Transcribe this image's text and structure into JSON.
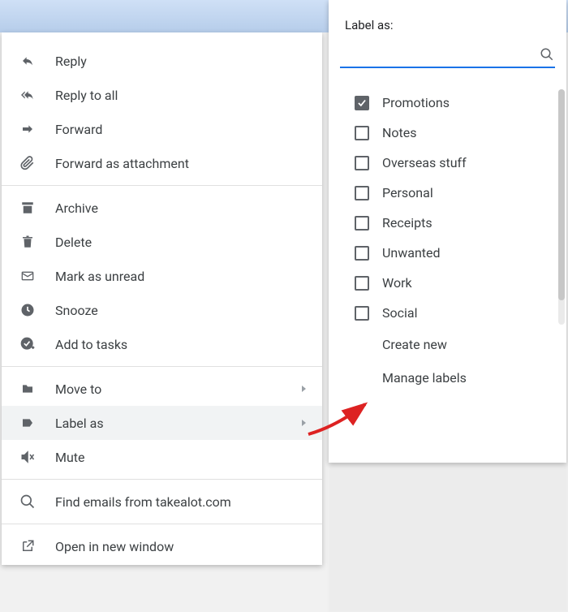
{
  "context_menu": {
    "groups": [
      [
        {
          "icon": "reply",
          "label": "Reply"
        },
        {
          "icon": "reply-all",
          "label": "Reply to all"
        },
        {
          "icon": "forward",
          "label": "Forward"
        },
        {
          "icon": "attachment",
          "label": "Forward as attachment"
        }
      ],
      [
        {
          "icon": "archive",
          "label": "Archive"
        },
        {
          "icon": "delete",
          "label": "Delete"
        },
        {
          "icon": "mark-unread",
          "label": "Mark as unread"
        },
        {
          "icon": "snooze",
          "label": "Snooze"
        },
        {
          "icon": "add-tasks",
          "label": "Add to tasks"
        }
      ],
      [
        {
          "icon": "move-to",
          "label": "Move to",
          "submenu": true
        },
        {
          "icon": "label",
          "label": "Label as",
          "submenu": true,
          "highlighted": true
        },
        {
          "icon": "mute",
          "label": "Mute"
        }
      ],
      [
        {
          "icon": "search",
          "label": "Find emails from takealot.com"
        }
      ],
      [
        {
          "icon": "open-new",
          "label": "Open in new window"
        }
      ]
    ]
  },
  "label_panel": {
    "title": "Label as:",
    "search_placeholder": "",
    "labels": [
      {
        "name": "Promotions",
        "checked": true
      },
      {
        "name": "Notes",
        "checked": false
      },
      {
        "name": "Overseas stuff",
        "checked": false
      },
      {
        "name": "Personal",
        "checked": false
      },
      {
        "name": "Receipts",
        "checked": false
      },
      {
        "name": "Unwanted",
        "checked": false
      },
      {
        "name": "Work",
        "checked": false
      },
      {
        "name": "Social",
        "checked": false
      }
    ],
    "actions": {
      "create_new": "Create new",
      "manage": "Manage labels"
    }
  }
}
